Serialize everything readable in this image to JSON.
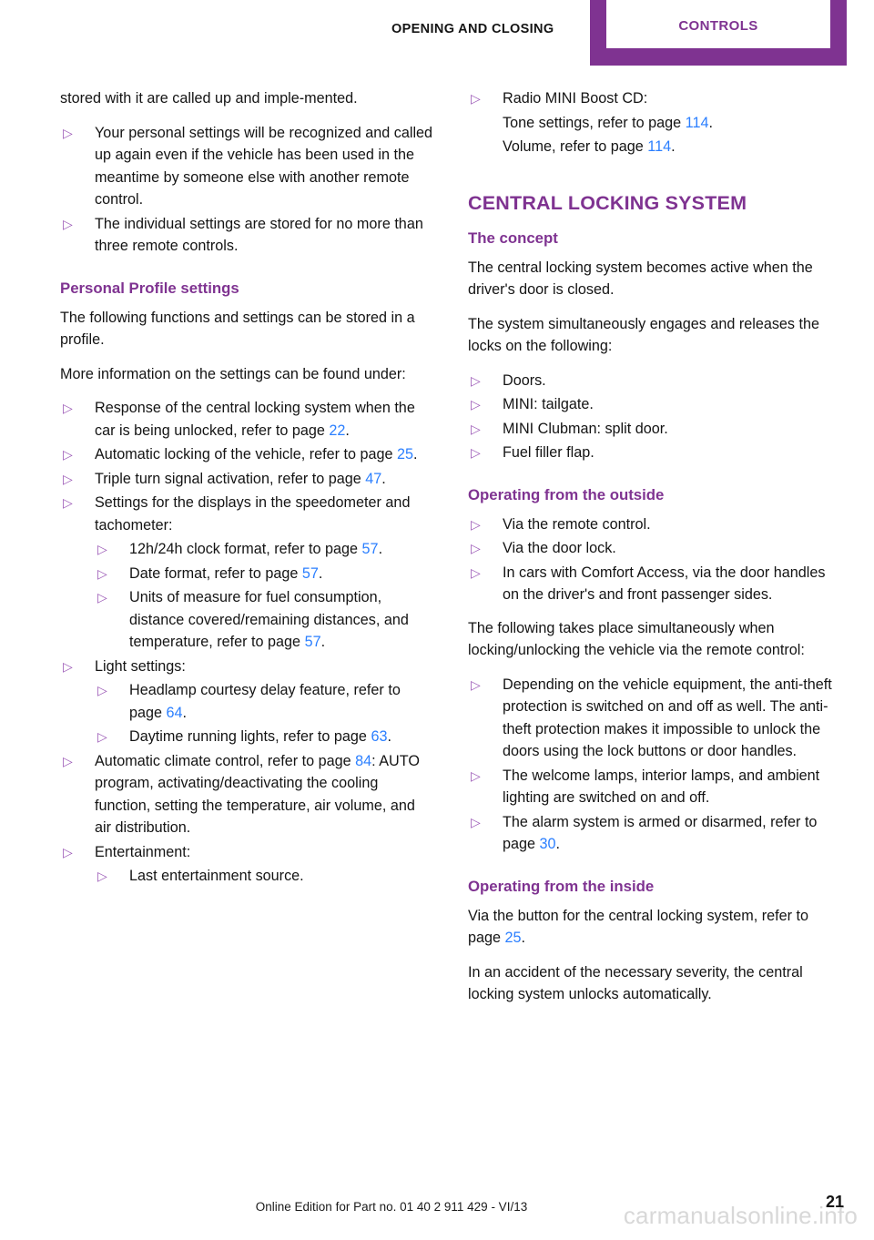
{
  "header": {
    "chapter": "OPENING AND CLOSING",
    "tab_label": "CONTROLS",
    "accent_color": "#7F3391"
  },
  "bullet_glyph": "▷",
  "left_column": {
    "continued_paragraph": "stored with it are called up and imple-mented.",
    "intro_bullets": [
      "Your personal settings will be recognized and called up again even if the vehicle has been used in the meantime by someone else with another remote control.",
      "The individual settings are stored for no more than three remote controls."
    ],
    "personal_profile": {
      "heading": "Personal Profile settings",
      "para_1": "The following functions and settings can be stored in a profile.",
      "para_2": "More information on the settings can be found under:",
      "items": [
        {
          "level": 1,
          "text_before": "Response of the central locking system when the car is being unlocked, refer to page ",
          "page": "22",
          "text_after": "."
        },
        {
          "level": 1,
          "text_before": "Automatic locking of the vehicle, refer to page ",
          "page": "25",
          "text_after": "."
        },
        {
          "level": 1,
          "text_before": "Triple turn signal activation, refer to page ",
          "page": "47",
          "text_after": "."
        },
        {
          "level": 1,
          "text_before": "Settings for the displays in the speedometer and tachometer:",
          "page": "",
          "text_after": ""
        },
        {
          "level": 2,
          "text_before": "12h/24h clock format, refer to page ",
          "page": "57",
          "text_after": "."
        },
        {
          "level": 2,
          "text_before": "Date format, refer to page ",
          "page": "57",
          "text_after": "."
        },
        {
          "level": 2,
          "text_before": "Units of measure for fuel consumption, distance covered/remaining distances, and temperature, refer to page ",
          "page": "57",
          "text_after": "."
        },
        {
          "level": 1,
          "text_before": "Light settings:",
          "page": "",
          "text_after": ""
        },
        {
          "level": 2,
          "text_before": "Headlamp courtesy delay feature, refer to page ",
          "page": "64",
          "text_after": "."
        },
        {
          "level": 2,
          "text_before": "Daytime running lights, refer to page ",
          "page": "63",
          "text_after": "."
        },
        {
          "level": 1,
          "text_before": "Automatic climate control, refer to page ",
          "page": "84",
          "text_after": ": AUTO program, activating/deactivating the cooling function, setting the temperature, air volume, and air distribution."
        },
        {
          "level": 1,
          "text_before": "Entertainment:",
          "page": "",
          "text_after": ""
        },
        {
          "level": 2,
          "text_before": "Last entertainment source.",
          "page": "",
          "text_after": ""
        }
      ]
    }
  },
  "right_column": {
    "radio_bullet": "Radio MINI Boost CD:",
    "radio_lines": [
      {
        "text_before": "Tone settings, refer to page ",
        "page": "114",
        "text_after": "."
      },
      {
        "text_before": "Volume, refer to page ",
        "page": "114",
        "text_after": "."
      }
    ],
    "section_title": "CENTRAL LOCKING SYSTEM",
    "concept": {
      "heading": "The concept",
      "para_1": "The central locking system becomes active when the driver's door is closed.",
      "para_2": "The system simultaneously engages and releases the locks on the following:",
      "items": [
        "Doors.",
        "MINI: tailgate.",
        "MINI Clubman: split door.",
        "Fuel filler flap."
      ]
    },
    "outside": {
      "heading": "Operating from the outside",
      "items_top": [
        "Via the remote control.",
        "Via the door lock.",
        "In cars with Comfort Access, via the door handles on the driver's and front passenger sides."
      ],
      "para": "The following takes place simultaneously when locking/unlocking the vehicle via the remote control:",
      "items_bottom": [
        {
          "text_before": "Depending on the vehicle equipment, the anti-theft protection is switched on and off as well. The anti-theft protection makes it impossible to unlock the doors using the lock buttons or door handles.",
          "page": "",
          "text_after": ""
        },
        {
          "text_before": "The welcome lamps, interior lamps, and ambient lighting are switched on and off.",
          "page": "",
          "text_after": ""
        },
        {
          "text_before": "The alarm system is armed or disarmed, refer to page ",
          "page": "30",
          "text_after": "."
        }
      ]
    },
    "inside": {
      "heading": "Operating from the inside",
      "para_1_before": "Via the button for the central locking system, refer to page ",
      "para_1_page": "25",
      "para_1_after": ".",
      "para_2": "In an accident of the necessary severity, the central locking system unlocks automatically."
    }
  },
  "footer": {
    "edition": "Online Edition for Part no. 01 40 2 911 429 - VI/13",
    "page_number": "21",
    "watermark": "carmanualsonline.info"
  }
}
